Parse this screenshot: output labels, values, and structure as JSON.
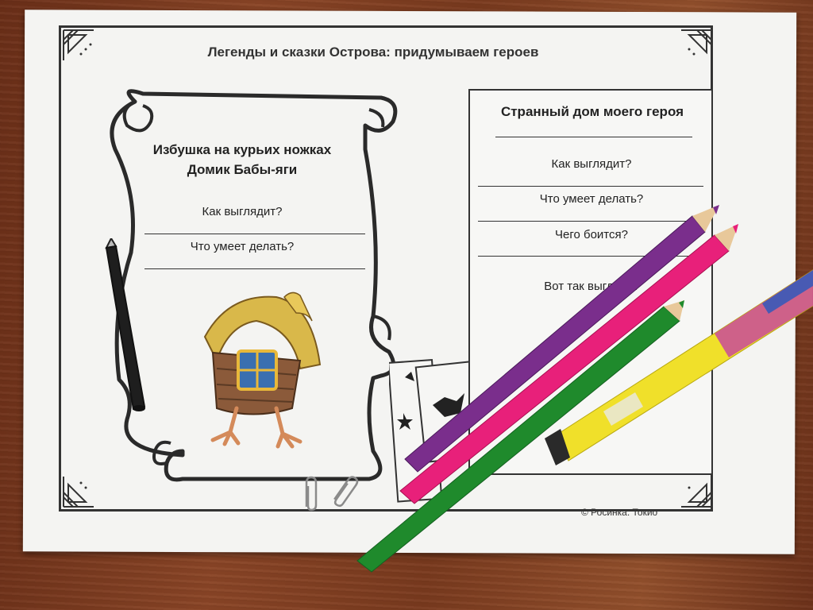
{
  "sheet": {
    "title": "Легенды и сказки Острова: придумываем героев",
    "copyright": "© Росинка. Токио"
  },
  "scroll": {
    "heading_line1": "Избушка на курьих ножках",
    "heading_line2": "Домик Бабы-яги",
    "question1": "Как выглядит?",
    "question2": "Что умеет делать?"
  },
  "card": {
    "title": "Странный дом моего героя",
    "question1": "Как выглядит?",
    "question2": "Что умеет делать?",
    "question3": "Чего боится?",
    "question4": "Вот так выглядит"
  },
  "colors": {
    "table": "#7a3a1e",
    "paper": "#f4f4f2",
    "pencil_purple": "#7a2e8c",
    "pencil_pink": "#e8207a",
    "pencil_green": "#1f8a2c",
    "marker_yellow": "#f2e41a"
  }
}
